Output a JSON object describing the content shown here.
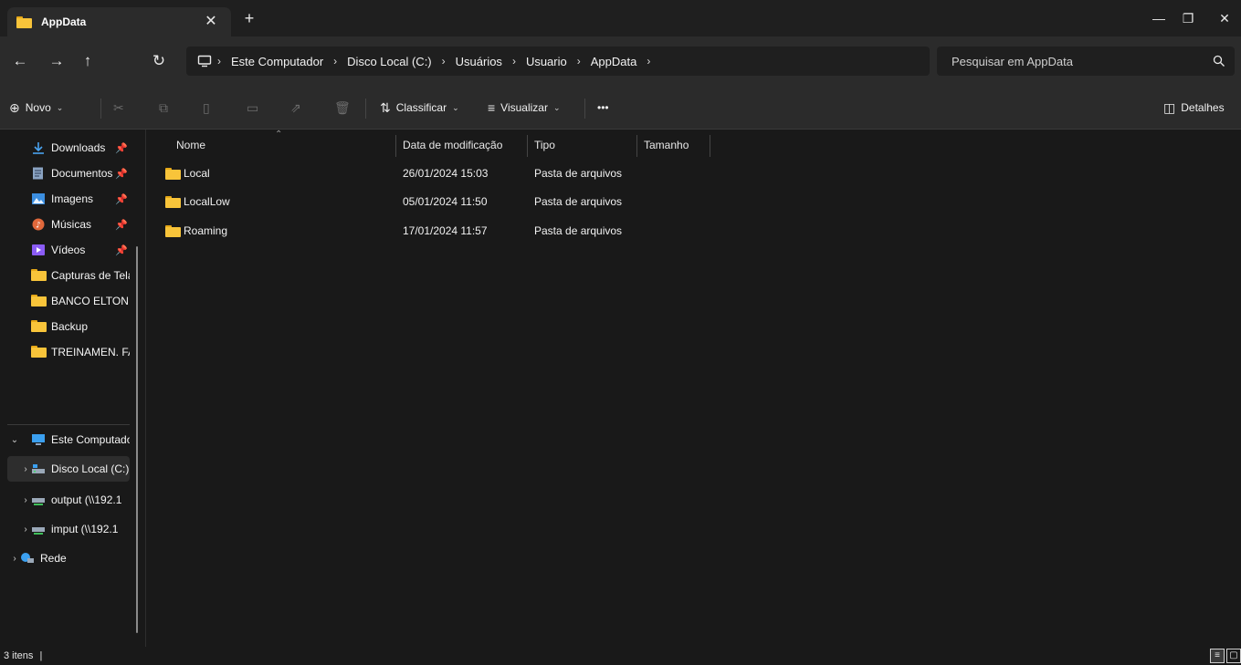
{
  "window": {
    "tab_title": "AppData",
    "tab_close": "✕",
    "new_tab": "+",
    "minimize": "—",
    "restore": "❐",
    "close": "✕"
  },
  "navigation": {
    "back": "←",
    "forward": "→",
    "up": "↑",
    "refresh": "↻",
    "breadcrumb": [
      "Este Computador",
      "Disco Local (C:)",
      "Usuários",
      "Usuario",
      "AppData"
    ],
    "separator": "›",
    "search_placeholder": "Pesquisar em AppData",
    "search_icon": "search-icon"
  },
  "commands": {
    "new_label": "Novo",
    "sort_label": "Classificar",
    "view_label": "Visualizar",
    "more_label": "•••",
    "details_label": "Detalhes"
  },
  "sidebar": {
    "quick_access": [
      {
        "label": "Downloads",
        "icon": "download-icon",
        "pinned": true
      },
      {
        "label": "Documentos",
        "icon": "document-icon",
        "pinned": true
      },
      {
        "label": "Imagens",
        "icon": "image-icon",
        "pinned": true
      },
      {
        "label": "Músicas",
        "icon": "music-icon",
        "pinned": true
      },
      {
        "label": "Vídeos",
        "icon": "video-icon",
        "pinned": true
      },
      {
        "label": "Capturas de Tela",
        "icon": "folder-icon",
        "pinned": false
      },
      {
        "label": "BANCO ELTON (",
        "icon": "folder-icon",
        "pinned": false
      },
      {
        "label": "Backup",
        "icon": "folder-icon",
        "pinned": false
      },
      {
        "label": "TREINAMEN. FA",
        "icon": "folder-icon",
        "pinned": false
      }
    ],
    "tree": [
      {
        "label": "Este Computador",
        "icon": "computer-icon",
        "expander": "⌄"
      },
      {
        "label": "Disco Local (C:)",
        "icon": "drive-icon",
        "expander": "›"
      },
      {
        "label": "output (\\\\192.1",
        "icon": "network-drive-icon",
        "expander": "›"
      },
      {
        "label": "imput (\\\\192.1",
        "icon": "network-drive-icon",
        "expander": "›"
      },
      {
        "label": "Rede",
        "icon": "network-icon",
        "expander": "›"
      }
    ]
  },
  "list": {
    "columns": [
      "Nome",
      "Data de modificação",
      "Tipo",
      "Tamanho"
    ],
    "rows": [
      {
        "name": "Local",
        "modified": "26/01/2024 15:03",
        "type": "Pasta de arquivos",
        "size": ""
      },
      {
        "name": "LocalLow",
        "modified": "05/01/2024 11:50",
        "type": "Pasta de arquivos",
        "size": ""
      },
      {
        "name": "Roaming",
        "modified": "17/01/2024 11:57",
        "type": "Pasta de arquivos",
        "size": ""
      }
    ]
  },
  "status": {
    "item_count": "3 itens",
    "cursor": "|"
  },
  "colors": {
    "background": "#191919",
    "toolbar": "#2b2b2b",
    "folder": "#f8c43a"
  }
}
